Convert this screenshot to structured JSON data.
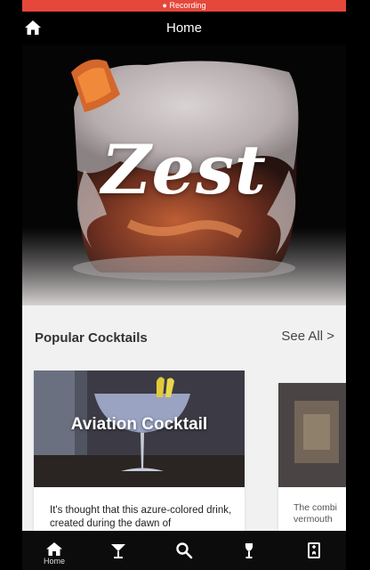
{
  "status": {
    "recording_text": "● Recording"
  },
  "header": {
    "title": "Home"
  },
  "hero": {
    "title": "Zest"
  },
  "section": {
    "title": "Popular Cocktails",
    "see_all": "See All >"
  },
  "cards": [
    {
      "title": "Aviation Cocktail",
      "description": "It's thought that this azure-colored drink, created during the dawn of"
    },
    {
      "title": "",
      "description": "The combi vermouth"
    }
  ],
  "nav": {
    "items": [
      {
        "label": "Home",
        "icon": "home-icon"
      },
      {
        "label": "",
        "icon": "cocktail-glass-icon"
      },
      {
        "label": "",
        "icon": "search-icon"
      },
      {
        "label": "",
        "icon": "wine-glass-icon"
      },
      {
        "label": "",
        "icon": "bookmark-icon"
      }
    ]
  },
  "colors": {
    "recording": "#e5483b",
    "topbar": "#000000",
    "content": "#f1f1f1"
  }
}
